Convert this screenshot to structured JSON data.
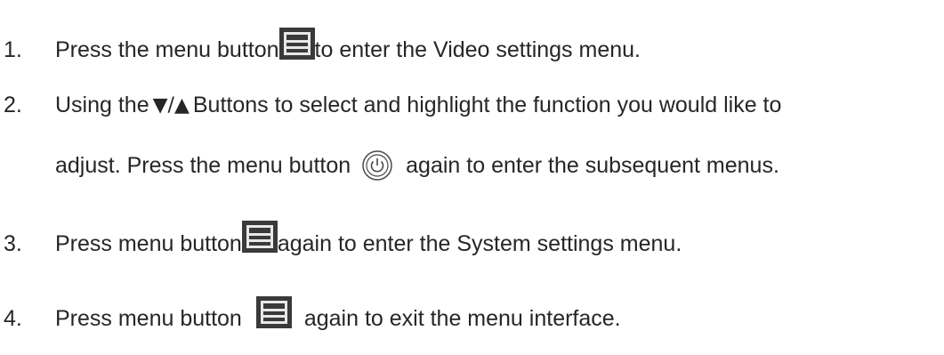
{
  "steps": [
    {
      "number": "1.",
      "before": "Press the menu button",
      "icon": "menu-icon",
      "after": "to enter the Video settings menu."
    },
    {
      "number": "2.",
      "before": "Using the",
      "arrows": "▼/▲",
      "after": "Buttons to select and highlight the function you would like to",
      "continuation_before": "adjust. Press the menu button",
      "icon": "power-icon",
      "continuation_after": "again to enter the subsequent menus."
    },
    {
      "number": "3.",
      "before": "Press menu button",
      "icon": "menu-icon",
      "after": "again to enter the System settings menu."
    },
    {
      "number": "4.",
      "before": "Press menu button",
      "icon": "menu-icon",
      "after": "again to exit the menu interface."
    }
  ]
}
